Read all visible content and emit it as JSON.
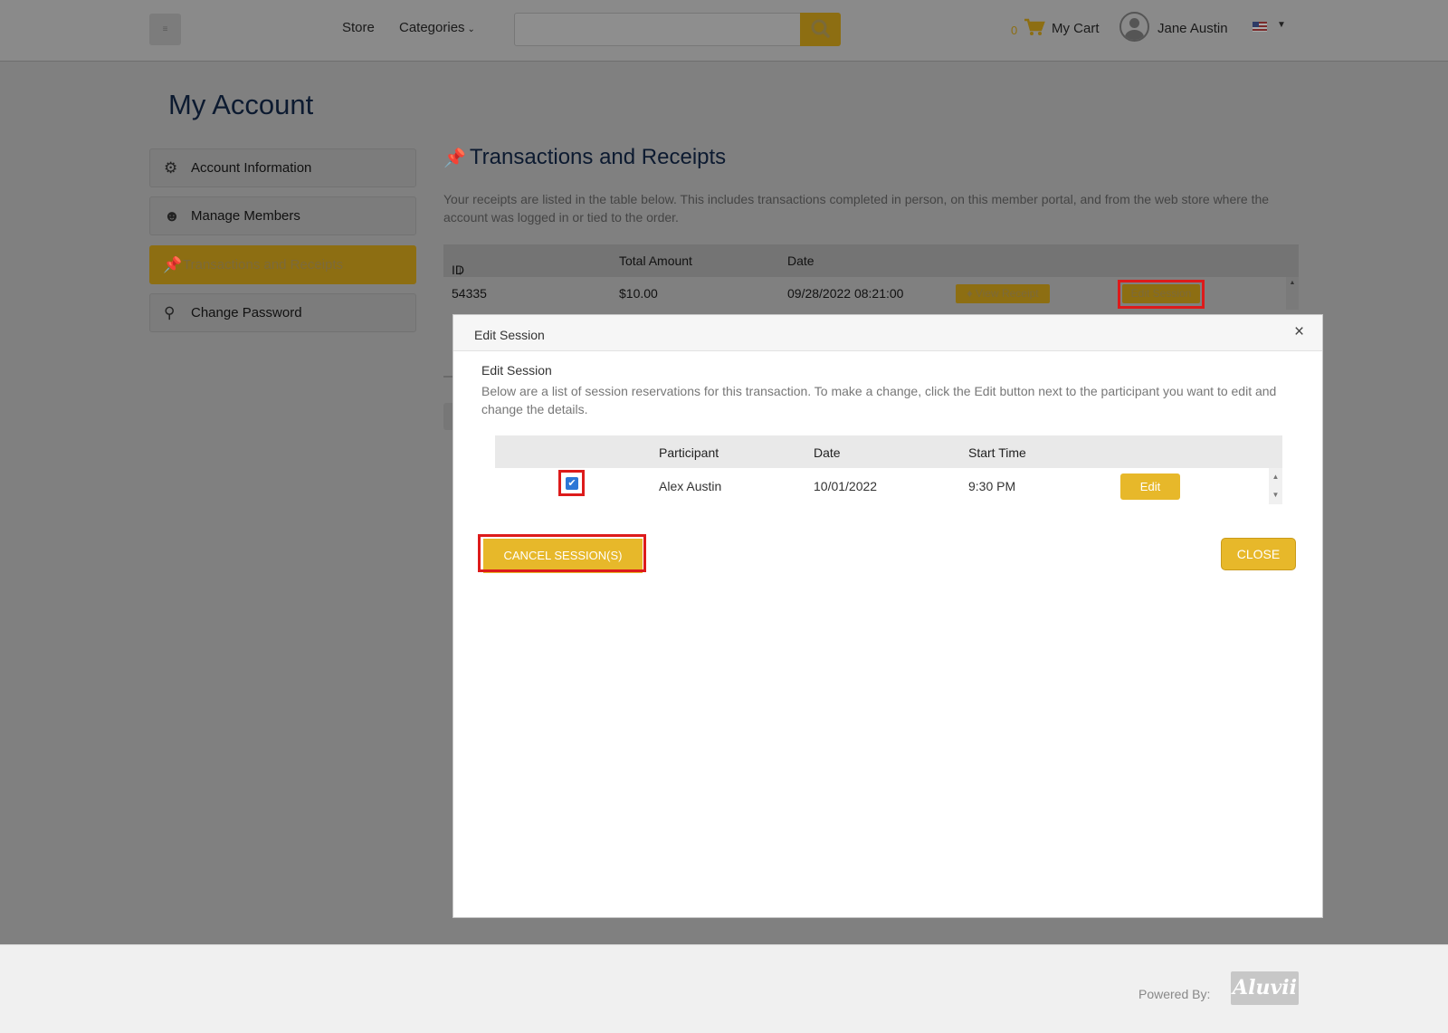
{
  "header": {
    "menu_toggle": "≡",
    "nav": {
      "store": "Store",
      "categories": "Categories"
    },
    "search": {
      "placeholder": ""
    },
    "cart": {
      "count": "0",
      "label": "My Cart"
    },
    "user": {
      "name": "Jane Austin"
    },
    "colors": {
      "accent": "#e7b82a",
      "accent_dimmed": "#8d6e12"
    }
  },
  "page": {
    "title": "My Account",
    "sidebar": {
      "items": [
        {
          "label": "Account Information",
          "icon": "gears-icon"
        },
        {
          "label": "Manage Members",
          "icon": "users-icon"
        },
        {
          "label": "Transactions and Receipts",
          "icon": "pin-icon",
          "active": true
        },
        {
          "label": "Change Password",
          "icon": "key-icon"
        }
      ]
    },
    "section": {
      "title": "Transactions and Receipts",
      "description": "Your receipts are listed in the table below. This includes transactions completed in person, on this member portal, and from the web store where the account was logged in or tied to the order."
    },
    "transactions": {
      "columns": {
        "id": "ID",
        "sort_indicator": "↓",
        "total": "Total Amount",
        "date": "Date"
      },
      "rows": [
        {
          "id": "54335",
          "total": "$10.00",
          "date": "09/28/2022 08:21:00",
          "view_receipt": "View Receipt",
          "edit_session": "Edit Session"
        }
      ]
    }
  },
  "modal": {
    "title": "Edit Session",
    "close_symbol": "×",
    "subtitle": "Edit Session",
    "description": "Below are a list of session reservations for this transaction. To make a change, click the Edit button next to the participant you want to edit and change the details.",
    "columns": {
      "participant": "Participant",
      "date": "Date",
      "start_time": "Start Time"
    },
    "rows": [
      {
        "checked": true,
        "participant": "Alex Austin",
        "date": "10/01/2022",
        "start_time": "9:30 PM",
        "edit_label": "Edit"
      }
    ],
    "cancel_button": "CANCEL SESSION(S)",
    "close_button": "CLOSE",
    "highlight_color": "#dd1b1b"
  },
  "footer": {
    "powered_by": "Powered By:",
    "logo_text": "Aluvii"
  }
}
